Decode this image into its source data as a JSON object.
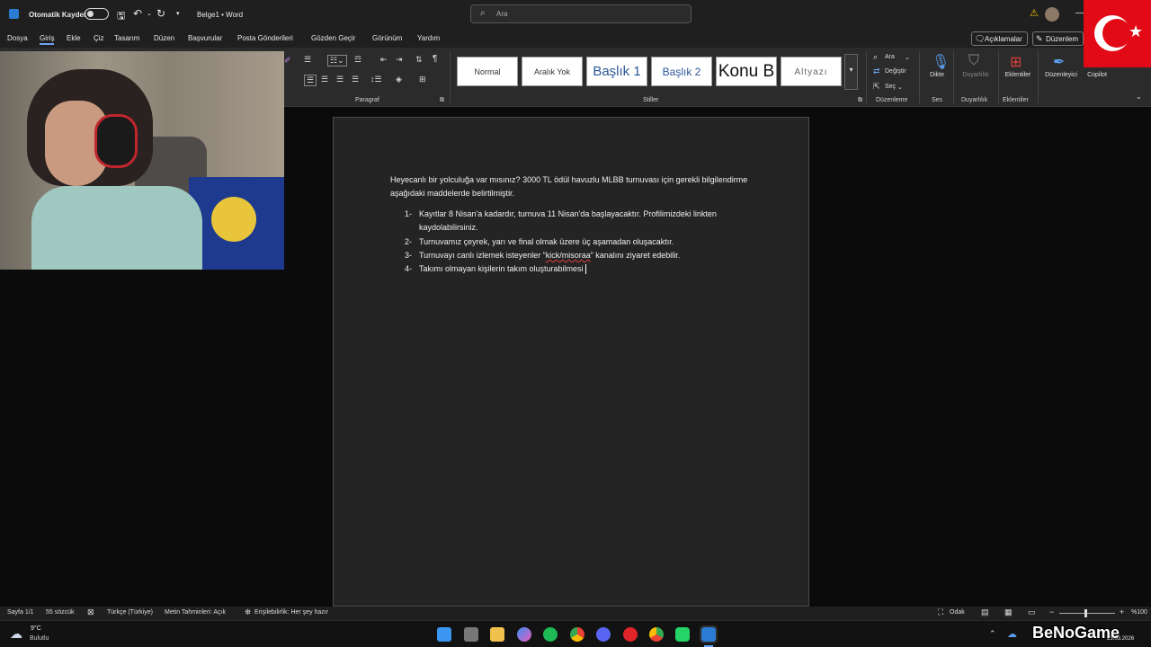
{
  "titlebar": {
    "autosave_label": "Otomatik Kaydet",
    "doc_title": "Belge1 • Word",
    "search_placeholder": "Ara",
    "minimize_glyph": "—"
  },
  "menu": {
    "items": [
      "Dosya",
      "Giriş",
      "Ekle",
      "Çiz",
      "Tasarım",
      "Düzen",
      "Başvurular",
      "Posta Gönderileri",
      "Gözden Geçir",
      "Görünüm",
      "Yardım"
    ],
    "active": "Giriş",
    "comments_label": "Açıklamalar",
    "editing_label": "Düzenlem"
  },
  "ribbon": {
    "paragraph_label": "Paragraf",
    "styles_label": "Stiller",
    "styles": [
      "Normal",
      "Aralık Yok",
      "Başlık 1",
      "Başlık 2",
      "Konu B",
      "Altyazı"
    ],
    "find_label": "Ara",
    "replace_label": "Değiştir",
    "select_label": "Seç",
    "editing_group_label": "Düzenleme",
    "dictate_label": "Dikte",
    "voice_group_label": "Ses",
    "sensitivity_label": "Duyarlılık",
    "sensitivity_group_label": "Duyarlılık",
    "addins_label": "Eklentiler",
    "addins_group_label": "Eklentiler",
    "editor_label": "Düzenleyici",
    "copilot_label": "Copilot"
  },
  "document": {
    "intro": "Heyecanlı bir yolculuğa var mısınız? 3000 TL ödül havuzlu MLBB turnuvası için gerekli bilgilendirme aşağıdaki maddelerde belirtilmiştir.",
    "items": [
      {
        "num": "1-",
        "text": "Kayıtlar 8 Nisan'a kadardır, turnuva 11 Nisan'da başlayacaktır. Profilimizdeki linkten kaydolabilirsiniz."
      },
      {
        "num": "2-",
        "text": "Turnuvamız çeyrek, yarı ve final olmak üzere üç aşamadan oluşacaktır."
      },
      {
        "num": "3-",
        "text_before": "Turnuvayı canlı izlemek isteyenler “",
        "link": "kick/misoraa",
        "text_after": "” kanalını ziyaret edebilir."
      },
      {
        "num": "4-",
        "text": "Takımı olmayan kişilerin takım oluşturabilmesi"
      }
    ]
  },
  "statusbar": {
    "page": "Sayfa 1/1",
    "words": "55 sözcük",
    "language": "Türkçe (Türkiye)",
    "predictions": "Metin Tahminleri: Açık",
    "accessibility": "Erişilebilirlik: Her şey hazır",
    "focus": "Odak",
    "zoom": "%100"
  },
  "taskbar": {
    "temp": "9°C",
    "weather": "Bulutlu",
    "date": "23.03.2026",
    "watermark": "BeNoGame"
  },
  "colors": {
    "flag_red": "#e30a17",
    "word_blue": "#2b7cd3",
    "active_underline": "#6ba3f2"
  }
}
